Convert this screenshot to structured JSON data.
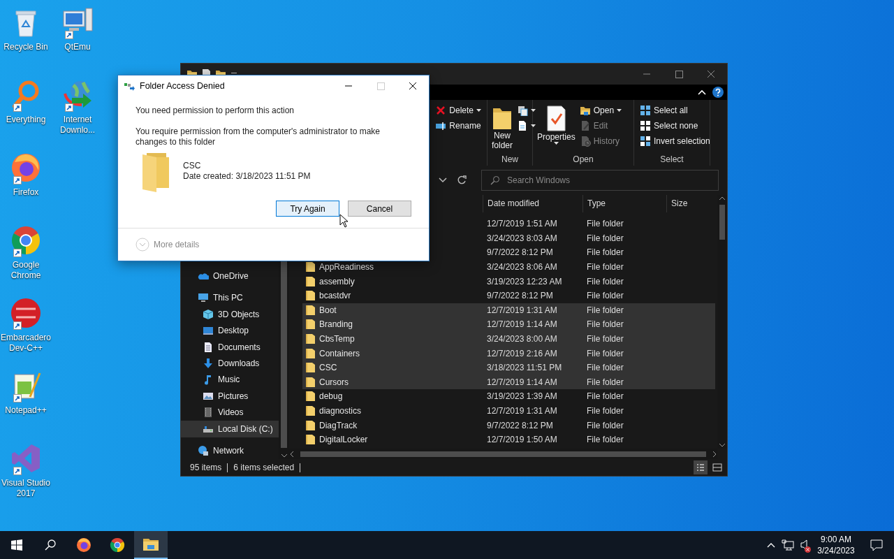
{
  "desktop": {
    "icons": [
      {
        "label": "Recycle Bin",
        "shortcut": false
      },
      {
        "label": "Everything",
        "shortcut": true
      },
      {
        "label": "Firefox",
        "shortcut": true
      },
      {
        "label": "Google Chrome",
        "shortcut": true
      },
      {
        "label": "Embarcadero Dev-C++",
        "shortcut": true
      },
      {
        "label": "Notepad++",
        "shortcut": true
      },
      {
        "label": "Visual Studio 2017",
        "shortcut": true
      },
      {
        "label": "QtEmu",
        "shortcut": true
      },
      {
        "label": "Internet Downlo...",
        "shortcut": true
      }
    ]
  },
  "explorer": {
    "ribbon": {
      "groups": [
        {
          "items": [
            {
              "kind": "small",
              "label": "Delete",
              "dropdown": true,
              "disabled": false
            },
            {
              "kind": "small",
              "label": "Rename",
              "dropdown": false,
              "disabled": false
            }
          ]
        },
        {
          "label": "New",
          "items": [
            {
              "kind": "large",
              "label": "New folder",
              "dropdown": false
            },
            {
              "kind": "icon",
              "dropdown": true,
              "disabled": false
            },
            {
              "kind": "icon",
              "dropdown": true,
              "disabled": false
            }
          ]
        },
        {
          "label": "Open",
          "items": [
            {
              "kind": "large",
              "label": "Properties",
              "dropdown": true
            },
            {
              "kind": "small",
              "label": "Open",
              "dropdown": true,
              "disabled": false
            },
            {
              "kind": "small",
              "label": "Edit",
              "dropdown": false,
              "disabled": true
            },
            {
              "kind": "small",
              "label": "History",
              "dropdown": false,
              "disabled": true
            }
          ]
        },
        {
          "label": "Select",
          "items": [
            {
              "kind": "small",
              "label": "Select all",
              "dropdown": false,
              "disabled": false
            },
            {
              "kind": "small",
              "label": "Select none",
              "dropdown": false,
              "disabled": false
            },
            {
              "kind": "small",
              "label": "Invert selection",
              "dropdown": false,
              "disabled": false
            }
          ]
        }
      ]
    },
    "search": {
      "placeholder": "Search Windows"
    },
    "nav": [
      {
        "label": "OneDrive",
        "selected": false
      },
      {
        "label": "This PC",
        "selected": false,
        "children": [
          {
            "label": "3D Objects",
            "selected": false
          },
          {
            "label": "Desktop",
            "selected": false
          },
          {
            "label": "Documents",
            "selected": false
          },
          {
            "label": "Downloads",
            "selected": false
          },
          {
            "label": "Music",
            "selected": false
          },
          {
            "label": "Pictures",
            "selected": false
          },
          {
            "label": "Videos",
            "selected": false
          },
          {
            "label": "Local Disk (C:)",
            "selected": true
          }
        ]
      },
      {
        "label": "Network",
        "selected": false
      }
    ],
    "columns": [
      "Date modified",
      "Type",
      "Size"
    ],
    "rows": [
      {
        "date": "12/7/2019 1:51 AM",
        "type": "File folder",
        "selected": false
      },
      {
        "date": "3/24/2023 8:03 AM",
        "type": "File folder",
        "selected": false
      },
      {
        "date": "9/7/2022 8:12 PM",
        "type": "File folder",
        "selected": false
      },
      {
        "name": "AppReadiness",
        "date": "3/24/2023 8:06 AM",
        "type": "File folder",
        "selected": false
      },
      {
        "name": "assembly",
        "date": "3/19/2023 12:23 AM",
        "type": "File folder",
        "selected": false
      },
      {
        "name": "bcastdvr",
        "date": "9/7/2022 8:12 PM",
        "type": "File folder",
        "selected": false
      },
      {
        "name": "Boot",
        "date": "12/7/2019 1:31 AM",
        "type": "File folder",
        "selected": true
      },
      {
        "name": "Branding",
        "date": "12/7/2019 1:14 AM",
        "type": "File folder",
        "selected": true
      },
      {
        "name": "CbsTemp",
        "date": "3/24/2023 8:00 AM",
        "type": "File folder",
        "selected": true
      },
      {
        "name": "Containers",
        "date": "12/7/2019 2:16 AM",
        "type": "File folder",
        "selected": true
      },
      {
        "name": "CSC",
        "date": "3/18/2023 11:51 PM",
        "type": "File folder",
        "selected": true
      },
      {
        "name": "Cursors",
        "date": "12/7/2019 1:14 AM",
        "type": "File folder",
        "selected": true
      },
      {
        "name": "debug",
        "date": "3/19/2023 1:39 AM",
        "type": "File folder",
        "selected": false
      },
      {
        "name": "diagnostics",
        "date": "12/7/2019 1:31 AM",
        "type": "File folder",
        "selected": false
      },
      {
        "name": "DiagTrack",
        "date": "9/7/2022 8:12 PM",
        "type": "File folder",
        "selected": false
      },
      {
        "name": "DigitalLocker",
        "date": "12/7/2019 1:50 AM",
        "type": "File folder",
        "selected": false
      }
    ],
    "status": {
      "count": "95 items",
      "selection": "6 items selected"
    }
  },
  "dialog": {
    "title": "Folder Access Denied",
    "controls": [
      {
        "kind": "minimize",
        "disabled": false
      },
      {
        "kind": "maximize",
        "disabled": true
      },
      {
        "kind": "close",
        "disabled": false
      }
    ],
    "heading": "You need permission to perform this action",
    "message": "You require permission from the computer's administrator to make changes to this folder",
    "item": {
      "name": "CSC",
      "created": "Date created: 3/18/2023 11:51 PM"
    },
    "buttons": [
      {
        "label": "Try Again",
        "focused": true
      },
      {
        "label": "Cancel",
        "focused": false
      }
    ],
    "details": "More details"
  },
  "taskbar": {
    "apps": [
      {
        "active": false
      },
      {
        "active": false
      },
      {
        "active": true
      }
    ],
    "volume_muted": true,
    "clock": {
      "time": "9:00 AM",
      "date": "3/24/2023"
    }
  }
}
